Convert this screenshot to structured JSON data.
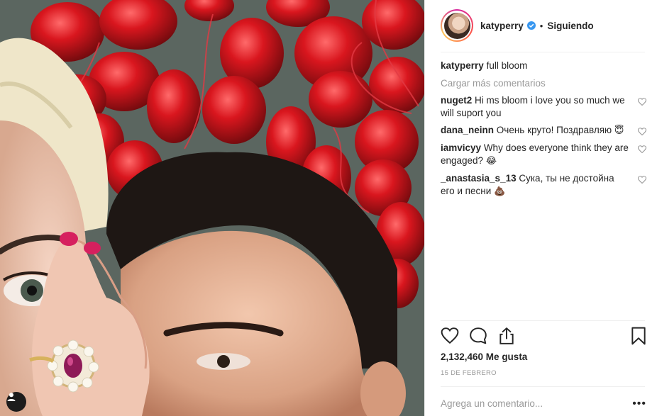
{
  "post": {
    "author": "katyperry",
    "follow_status": "Siguiendo",
    "separator": "•"
  },
  "caption": {
    "user": "katyperry",
    "text": "full bloom"
  },
  "load_more_label": "Cargar más comentarios",
  "comments": [
    {
      "user": "nuget2",
      "text": "Hi ms bloom i love you so much we will suport you",
      "emoji": ""
    },
    {
      "user": "dana_neinn",
      "text": "Очень круто! Поздравляю",
      "emoji": "😇"
    },
    {
      "user": "iamvicyy",
      "text": "Why does everyone think they are engaged?",
      "emoji": "😂"
    },
    {
      "user": "_anastasia_s_13",
      "text": "Сука, ты не достойна его и песни",
      "emoji": "💩"
    }
  ],
  "likes_label": "2,132,460 Me gusta",
  "date_label": "15 DE FEBRERO",
  "comment_input": {
    "placeholder": "Agrega un comentario..."
  },
  "more_options": "•••",
  "icons": {
    "verified": "verified-badge-icon",
    "like": "heart-icon",
    "comment": "speech-bubble-icon",
    "share": "share-icon",
    "save": "bookmark-icon",
    "user_tag": "person-icon"
  },
  "colors": {
    "accent_blue": "#3897f0",
    "text": "#262626",
    "muted": "#999999"
  }
}
